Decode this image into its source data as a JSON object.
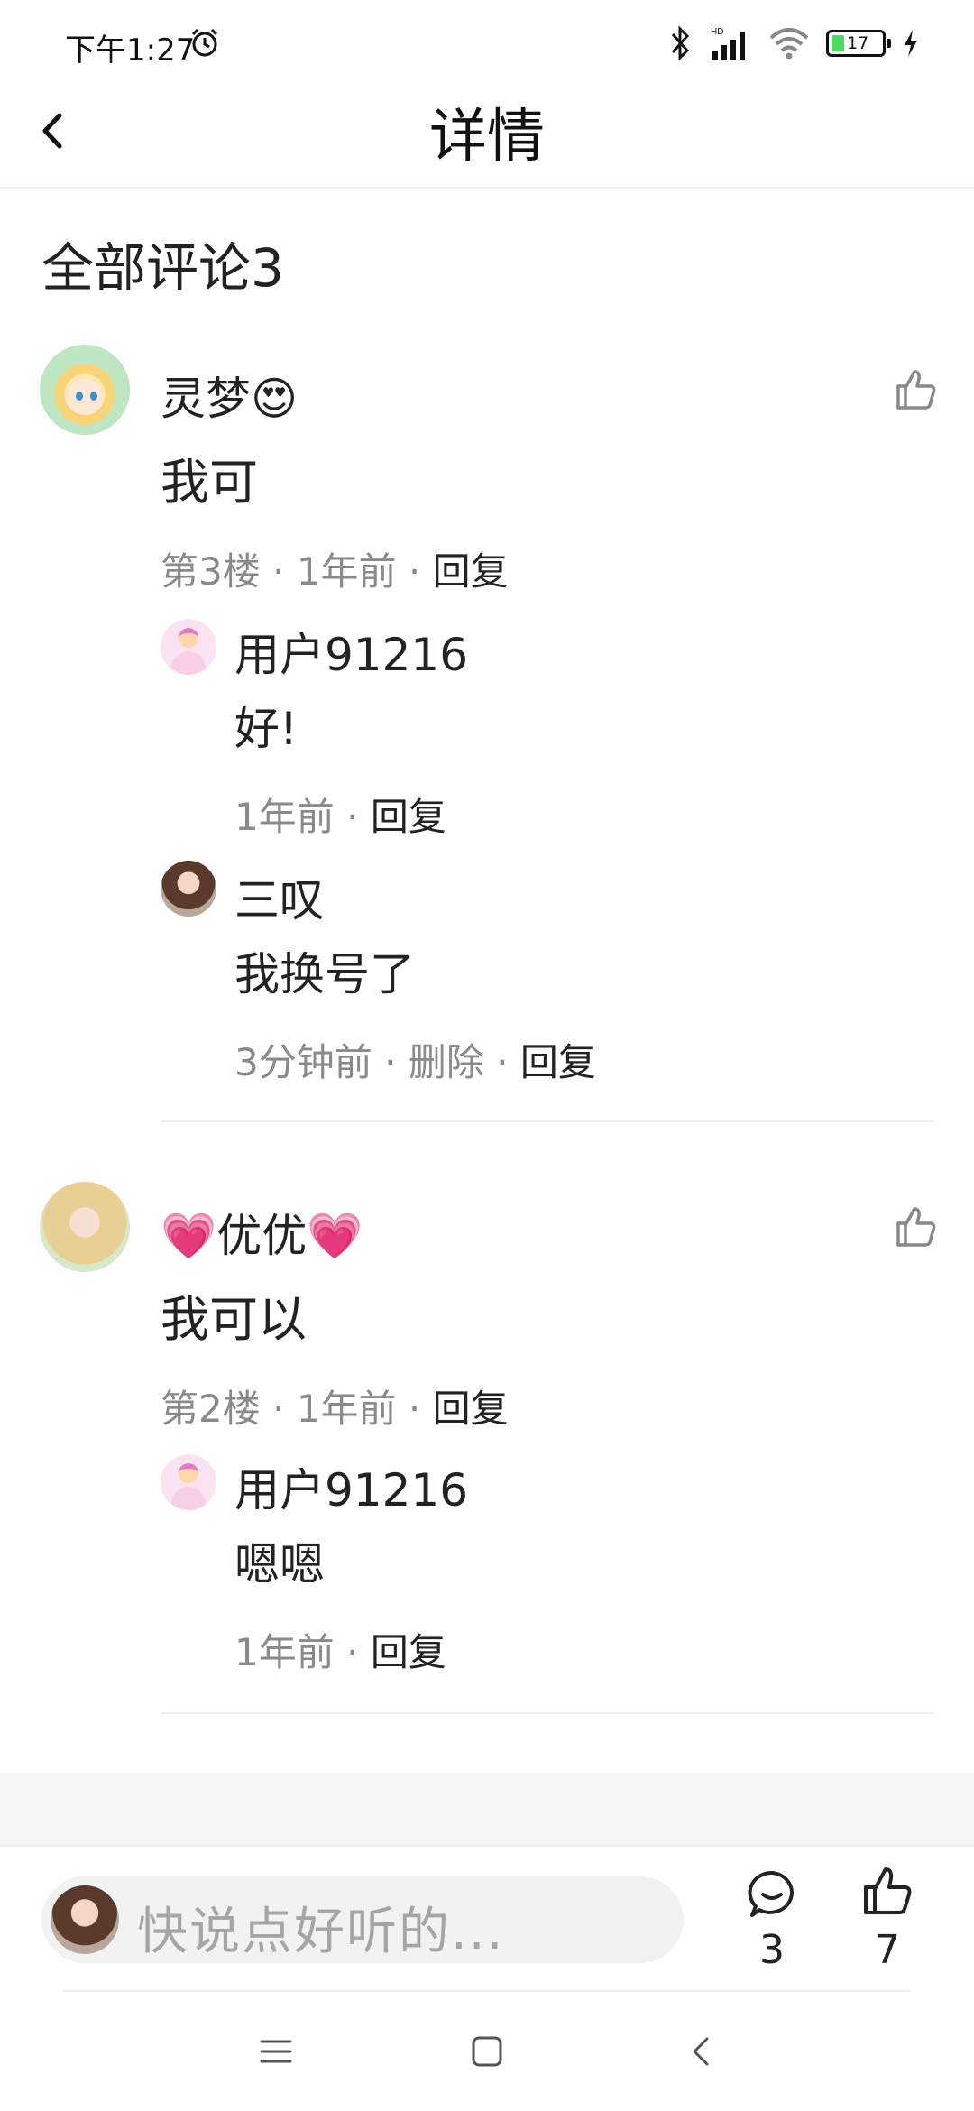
{
  "status_bar": {
    "time": "下午1:27",
    "battery": "17"
  },
  "header": {
    "title": "详情"
  },
  "section": {
    "title": "全部评论3"
  },
  "comments": [
    {
      "author": "灵梦😍",
      "content": "我可",
      "floor": "第3楼",
      "time": "1年前",
      "reply": "回复",
      "replies": [
        {
          "author": "用户91216",
          "content": "好!",
          "time": "1年前",
          "reply": "回复"
        },
        {
          "author": "三叹",
          "content": "我换号了",
          "time": "3分钟前",
          "delete": "删除",
          "reply": "回复"
        }
      ]
    },
    {
      "author": "💗优优💗",
      "content": "我可以",
      "floor": "第2楼",
      "time": "1年前",
      "reply": "回复",
      "replies": [
        {
          "author": "用户91216",
          "content": "嗯嗯",
          "time": "1年前",
          "reply": "回复"
        }
      ]
    }
  ],
  "bottom_bar": {
    "placeholder": "快说点好听的...",
    "comment_count": "3",
    "like_count": "7"
  },
  "meta_separator": "·",
  "colors": {
    "meta_gray": "#8a8a8a",
    "text": "#222222",
    "battery_green": "#4cd964"
  }
}
